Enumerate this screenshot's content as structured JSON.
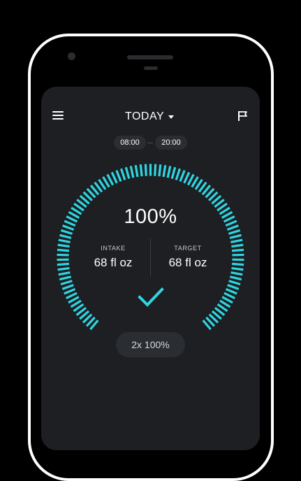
{
  "header": {
    "title": "TODAY",
    "menu_icon": "hamburger-menu-icon",
    "flag_icon": "flag-icon"
  },
  "schedule": {
    "start_time": "08:00",
    "end_time": "20:00"
  },
  "progress": {
    "percent_label": "100%",
    "fraction": 1.0
  },
  "stats": {
    "intake_label": "INTAKE",
    "intake_value": "68 fl oz",
    "target_label": "TARGET",
    "target_value": "68 fl oz"
  },
  "status_icon": "checkmark-icon",
  "multiplier_label": "2x 100%",
  "colors": {
    "accent": "#2fd6e0",
    "screen_bg": "#1d1f23",
    "pill_bg": "#2a2d32"
  }
}
